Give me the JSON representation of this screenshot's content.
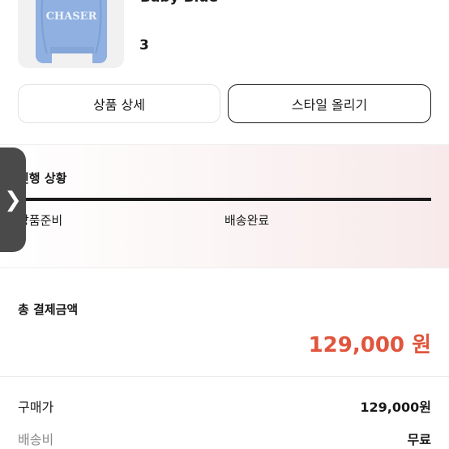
{
  "product": {
    "variant": "Baby Blue",
    "quantity": "3",
    "image_icon": "sweatshirt-icon",
    "image_text": "CHASER"
  },
  "buttons": {
    "detail_label": "상품 상세",
    "style_label": "스타일 올리기"
  },
  "status": {
    "title": "진행 상황",
    "steps": [
      "상품준비",
      "배송완료"
    ],
    "side_tab_icon": "chevron-right-icon"
  },
  "payment": {
    "total_label": "총 결제금액",
    "total_amount": "129,000 원",
    "rows": [
      {
        "label": "구매가",
        "value": "129,000원"
      },
      {
        "label": "배송비",
        "value": "무료"
      }
    ]
  },
  "colors": {
    "accent_red": "#e0553d",
    "tab_gray": "#4a4a4a",
    "sweatshirt_blue": "#8fb0e0"
  }
}
